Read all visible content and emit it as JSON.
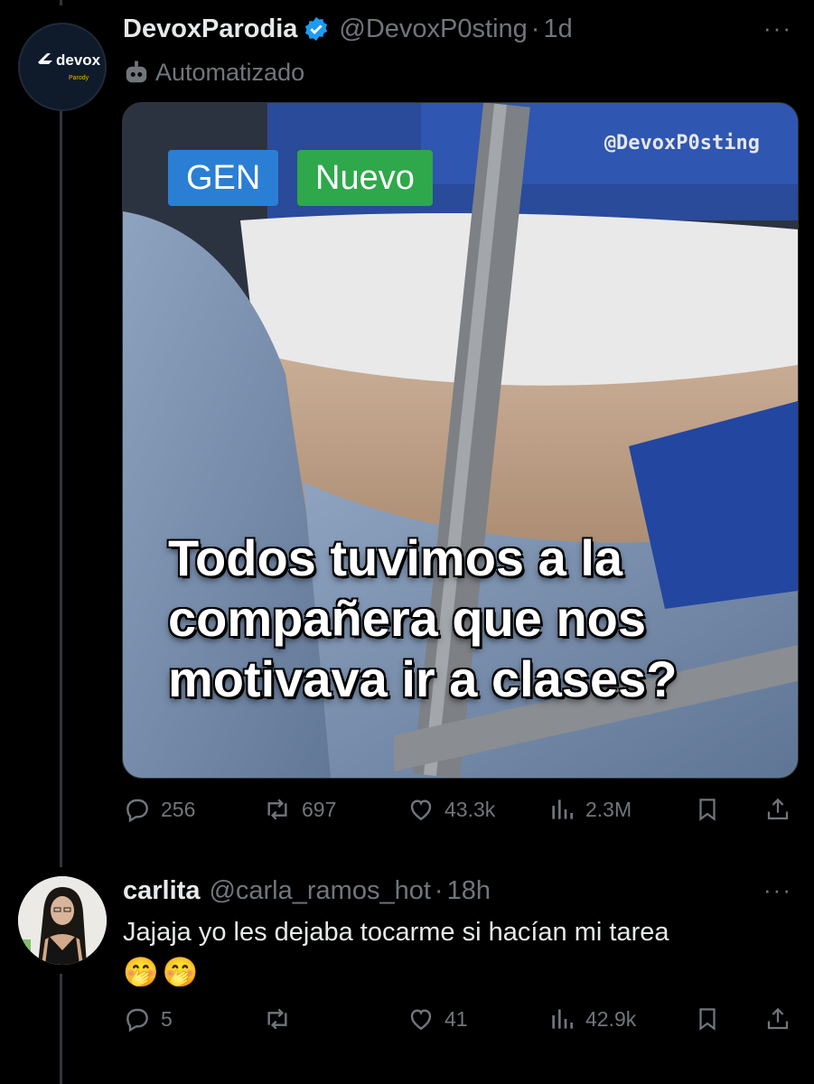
{
  "post": {
    "author_name": "DevoxParodia",
    "handle": "@DevoxP0sting",
    "time": "1d",
    "label": "Automatizado",
    "avatar_logo": "devox",
    "avatar_sub": "Parody",
    "verified_icon": "verified-badge-icon",
    "media": {
      "tag_gen": "GEN",
      "tag_new": "Nuevo",
      "watermark": "@DevoxP0sting",
      "caption": "Todos tuvimos a la compañera que nos motivava ir a clases?"
    },
    "stats": {
      "replies": "256",
      "reposts": "697",
      "likes": "43.3k",
      "views": "2.3M"
    }
  },
  "reply": {
    "author_name": "carlita",
    "handle": "@carla_ramos_hot",
    "time": "18h",
    "text": "Jajaja yo les dejaba tocarme si hacían mi tarea",
    "emojis": "🤭🤭",
    "stats": {
      "replies": "5",
      "reposts": "",
      "likes": "41",
      "views": "42.9k"
    }
  },
  "colors": {
    "background": "#000000",
    "text": "#e7e9ea",
    "muted": "#71767b",
    "verified": "#1d9bf0",
    "tag_gen": "#2a7fd4",
    "tag_new": "#2ea84a"
  },
  "icons": [
    "reply-icon",
    "repost-icon",
    "like-icon",
    "views-icon",
    "bookmark-icon",
    "share-icon",
    "more-icon",
    "bot-icon"
  ]
}
